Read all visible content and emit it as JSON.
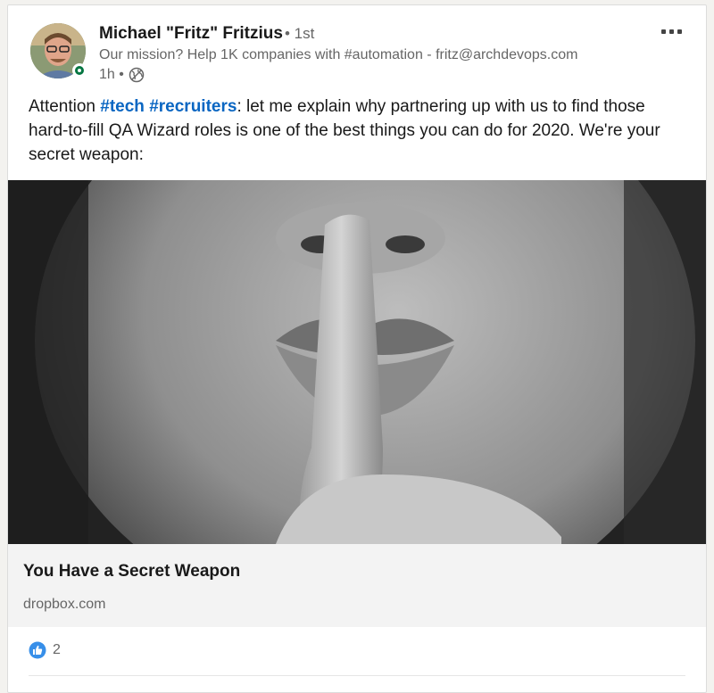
{
  "post": {
    "author_name": "Michael \"Fritz\" Fritzius",
    "connection_degree": "• 1st",
    "headline": "Our mission? Help 1K companies with #automation - fritz@archdevops.com",
    "time_ago": "1h •",
    "visibility_icon": "globe-icon",
    "menu_icon": "more-options-icon",
    "commentary": {
      "prefix": "Attention ",
      "hashtag_1": "#tech",
      "space": " ",
      "hashtag_2": "#recruiters",
      "rest": ": let me explain why partnering up with us to find those hard-to-fill QA Wizard roles is one of the best things you can do for 2020. We're your secret weapon:"
    }
  },
  "link_preview": {
    "title": "You Have a Secret Weapon",
    "domain": "dropbox.com"
  },
  "social_counts": {
    "reaction_icon": "like-icon",
    "reactions": "2"
  },
  "colors": {
    "accent": "#0a66c2",
    "presence": "#057642",
    "link_bg": "#f3f3f3"
  }
}
